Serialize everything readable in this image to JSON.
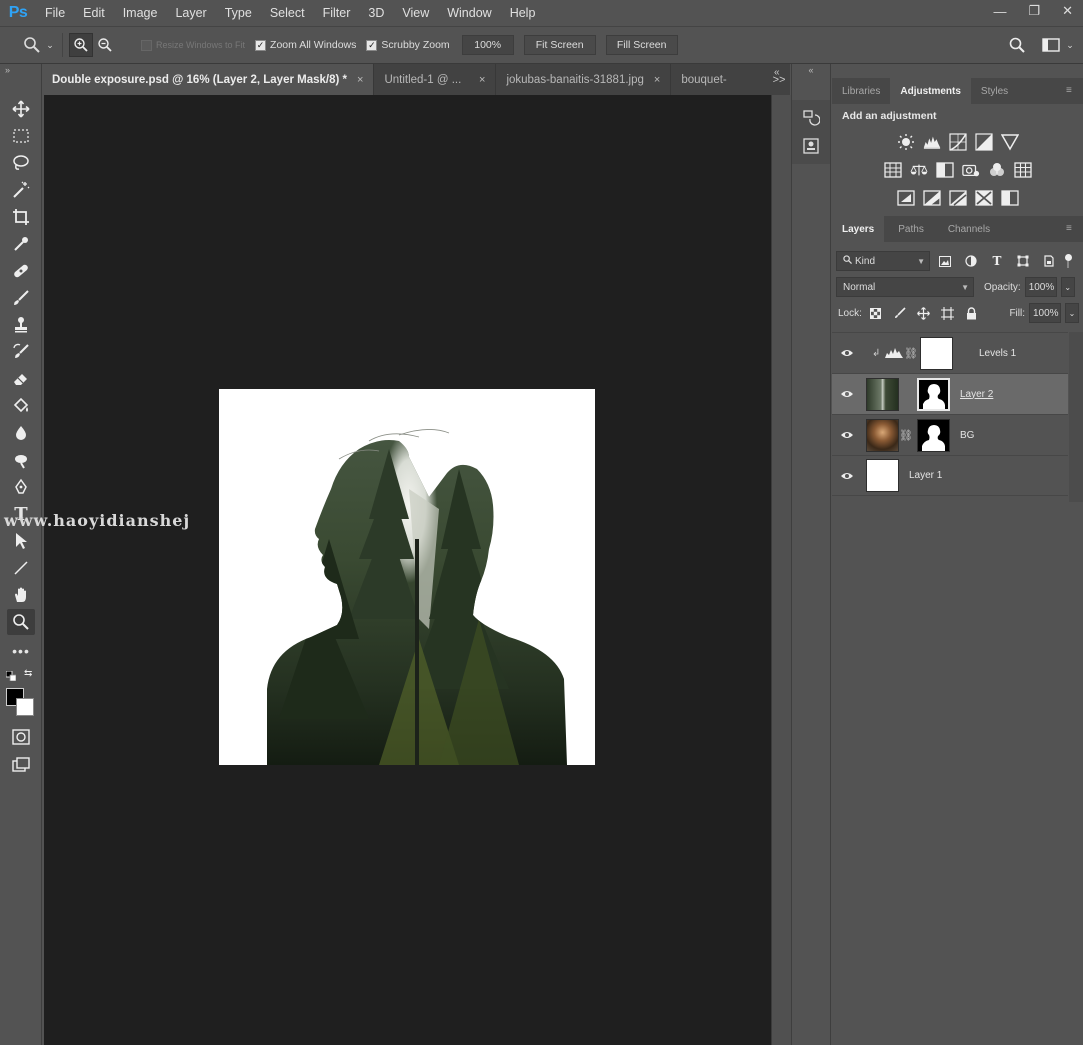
{
  "app": {
    "logo": "Ps"
  },
  "menu": [
    "File",
    "Edit",
    "Image",
    "Layer",
    "Type",
    "Select",
    "Filter",
    "3D",
    "View",
    "Window",
    "Help"
  ],
  "window_controls": {
    "minimize": "—",
    "maximize": "❐",
    "close": "✕"
  },
  "options": {
    "resize_windows": "Resize Windows to Fit",
    "zoom_all": "Zoom All Windows",
    "scrubby": "Scrubby Zoom",
    "zoom_value": "100%",
    "fit_screen": "Fit Screen",
    "fill_screen": "Fill Screen"
  },
  "tabs": [
    {
      "label": "Double exposure.psd @ 16% (Layer 2, Layer Mask/8) *",
      "close": "×"
    },
    {
      "label": "Untitled-1 @ ...",
      "close": "×"
    },
    {
      "label": "jokubas-banaitis-31881.jpg",
      "close": "×"
    },
    {
      "label": "bouquet-",
      "close": ""
    }
  ],
  "tabs_more": ">>",
  "watermark": "www.haoyidianshej",
  "adjustments_panel": {
    "tabs": [
      "Libraries",
      "Adjustments",
      "Styles"
    ],
    "title": "Add an adjustment"
  },
  "layers_panel": {
    "tabs": [
      "Layers",
      "Paths",
      "Channels"
    ],
    "filter": "Kind",
    "blend_mode": "Normal",
    "opacity_label": "Opacity:",
    "opacity_value": "100%",
    "lock_label": "Lock:",
    "fill_label": "Fill:",
    "fill_value": "100%",
    "layers": [
      {
        "name": "Levels 1"
      },
      {
        "name": "Layer 2"
      },
      {
        "name": "BG"
      },
      {
        "name": "Layer 1"
      }
    ]
  },
  "colors": {
    "accent": "#2fa3f6",
    "canvas_bg": "#1f1f1f",
    "panel_bg": "#535353",
    "selected_layer": "#6a6a6a"
  }
}
